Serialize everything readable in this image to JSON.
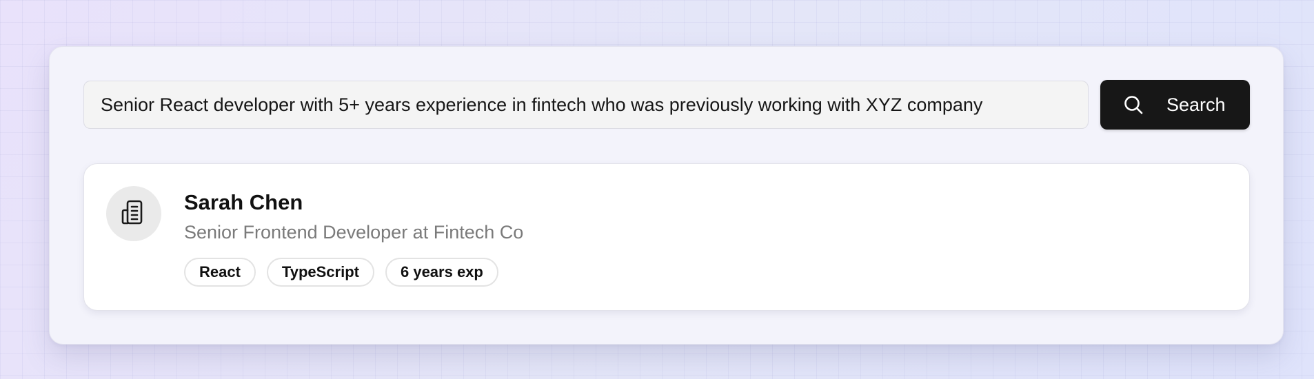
{
  "search": {
    "query": "Senior React developer with 5+ years experience in fintech who was previously working with XYZ company",
    "button_label": "Search",
    "button_icon": "search-icon",
    "button_color": "#171717"
  },
  "results": [
    {
      "avatar_icon": "building-icon",
      "name": "Sarah Chen",
      "role": "Senior Frontend Developer at Fintech Co",
      "tags": [
        "React",
        "TypeScript",
        "6 years exp"
      ]
    }
  ]
}
